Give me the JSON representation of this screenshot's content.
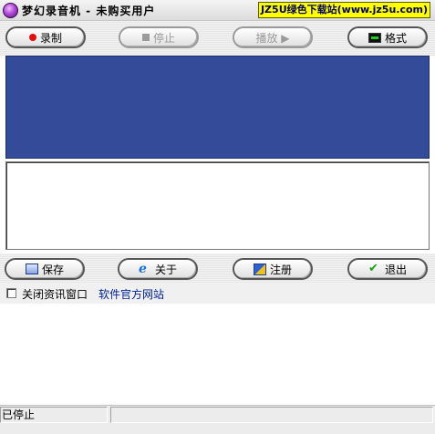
{
  "window": {
    "title": "梦幻录音机 - 未购买用户",
    "watermark": "JZ5U绿色下载站(www.jz5u.com)"
  },
  "toolbar_top": {
    "record_label": "录制",
    "stop_label": "停止",
    "play_label": "播放 ▶",
    "format_label": "格式"
  },
  "toolbar_bottom": {
    "save_label": "保存",
    "about_label": "关于",
    "register_label": "注册",
    "exit_label": "退出"
  },
  "options": {
    "close_info_label": "关闭资讯窗口",
    "close_info_checked": false,
    "website_link": "软件官方网站"
  },
  "status": {
    "text": "已停止"
  },
  "colors": {
    "display_bg": "#334b99",
    "watermark_bg": "#ffff00",
    "link": "#00209a"
  }
}
